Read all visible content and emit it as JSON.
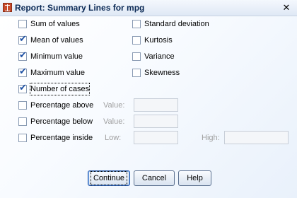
{
  "window": {
    "title": "Report: Summary Lines for mpg",
    "close_glyph": "✕"
  },
  "checkboxes_left": [
    {
      "label": "Sum of values",
      "checked": false
    },
    {
      "label": "Mean of values",
      "checked": true
    },
    {
      "label": "Minimum value",
      "checked": true
    },
    {
      "label": "Maximum value",
      "checked": true
    },
    {
      "label": "Number of cases",
      "checked": true
    },
    {
      "label": "Percentage above",
      "checked": false
    },
    {
      "label": "Percentage below",
      "checked": false
    },
    {
      "label": "Percentage inside",
      "checked": false
    }
  ],
  "checkboxes_right": [
    {
      "label": "Standard deviation",
      "checked": false,
      "disabled": false
    },
    {
      "label": "Kurtosis",
      "checked": false,
      "disabled": false
    },
    {
      "label": "Variance",
      "checked": false,
      "disabled": false
    },
    {
      "label": "Skewness",
      "checked": false,
      "disabled": true
    }
  ],
  "percentage": {
    "above_value_label": "Value:",
    "below_value_label": "Value:",
    "inside_low_label": "Low:",
    "inside_high_label": "High:",
    "above_value": "",
    "below_value": "",
    "inside_low": "",
    "inside_high": ""
  },
  "buttons": {
    "continue": "Continue",
    "cancel": "Cancel",
    "help": "Help"
  }
}
